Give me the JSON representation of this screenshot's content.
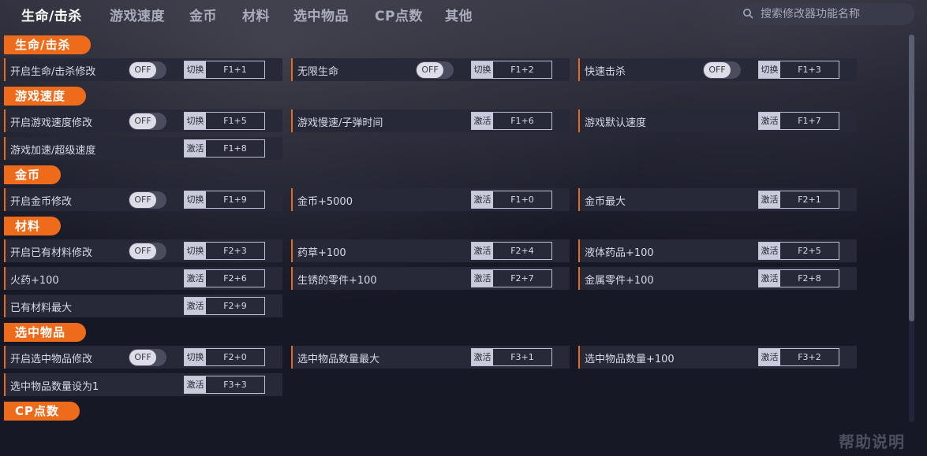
{
  "nav": {
    "tabs": [
      "生命/击杀",
      "游戏速度",
      "金币",
      "材料",
      "选中物品",
      "CP点数",
      "其他"
    ],
    "active_tab": "生命/击杀",
    "search_placeholder": "搜索修改器功能名称"
  },
  "toggle_text": "OFF",
  "sections": [
    {
      "title": "生命/击杀",
      "rows": [
        {
          "label": "开启生命/击杀修改",
          "toggle": true,
          "mode": "切换",
          "key": "F1+1"
        },
        {
          "label": "无限生命",
          "toggle": true,
          "mode": "切换",
          "key": "F1+2"
        },
        {
          "label": "快速击杀",
          "toggle": true,
          "mode": "切换",
          "key": "F1+3"
        }
      ]
    },
    {
      "title": "游戏速度",
      "rows": [
        {
          "label": "开启游戏速度修改",
          "toggle": true,
          "mode": "切换",
          "key": "F1+5"
        },
        {
          "label": "游戏慢速/子弹时间",
          "toggle": false,
          "mode": "激活",
          "key": "F1+6"
        },
        {
          "label": "游戏默认速度",
          "toggle": false,
          "mode": "激活",
          "key": "F1+7"
        },
        {
          "label": "游戏加速/超级速度",
          "toggle": false,
          "mode": "激活",
          "key": "F1+8"
        }
      ]
    },
    {
      "title": "金币",
      "rows": [
        {
          "label": "开启金币修改",
          "toggle": true,
          "mode": "切换",
          "key": "F1+9"
        },
        {
          "label": "金币+5000",
          "toggle": false,
          "mode": "激活",
          "key": "F1+0"
        },
        {
          "label": "金币最大",
          "toggle": false,
          "mode": "激活",
          "key": "F2+1"
        }
      ]
    },
    {
      "title": "材料",
      "rows": [
        {
          "label": "开启已有材料修改",
          "toggle": true,
          "mode": "切换",
          "key": "F2+3"
        },
        {
          "label": "药草+100",
          "toggle": false,
          "mode": "激活",
          "key": "F2+4"
        },
        {
          "label": "液体药品+100",
          "toggle": false,
          "mode": "激活",
          "key": "F2+5"
        },
        {
          "label": "火药+100",
          "toggle": false,
          "mode": "激活",
          "key": "F2+6"
        },
        {
          "label": "生锈的零件+100",
          "toggle": false,
          "mode": "激活",
          "key": "F2+7"
        },
        {
          "label": "金属零件+100",
          "toggle": false,
          "mode": "激活",
          "key": "F2+8"
        },
        {
          "label": "已有材料最大",
          "toggle": false,
          "mode": "激活",
          "key": "F2+9"
        }
      ]
    },
    {
      "title": "选中物品",
      "rows": [
        {
          "label": "开启选中物品修改",
          "toggle": true,
          "mode": "切换",
          "key": "F2+0"
        },
        {
          "label": "选中物品数量最大",
          "toggle": false,
          "mode": "激活",
          "key": "F3+1"
        },
        {
          "label": "选中物品数量+100",
          "toggle": false,
          "mode": "激活",
          "key": "F3+2"
        },
        {
          "label": "选中物品数量设为1",
          "toggle": false,
          "mode": "激活",
          "key": "F3+3"
        }
      ]
    },
    {
      "title": "CP点数",
      "rows": []
    }
  ],
  "help_text": "帮助说明"
}
